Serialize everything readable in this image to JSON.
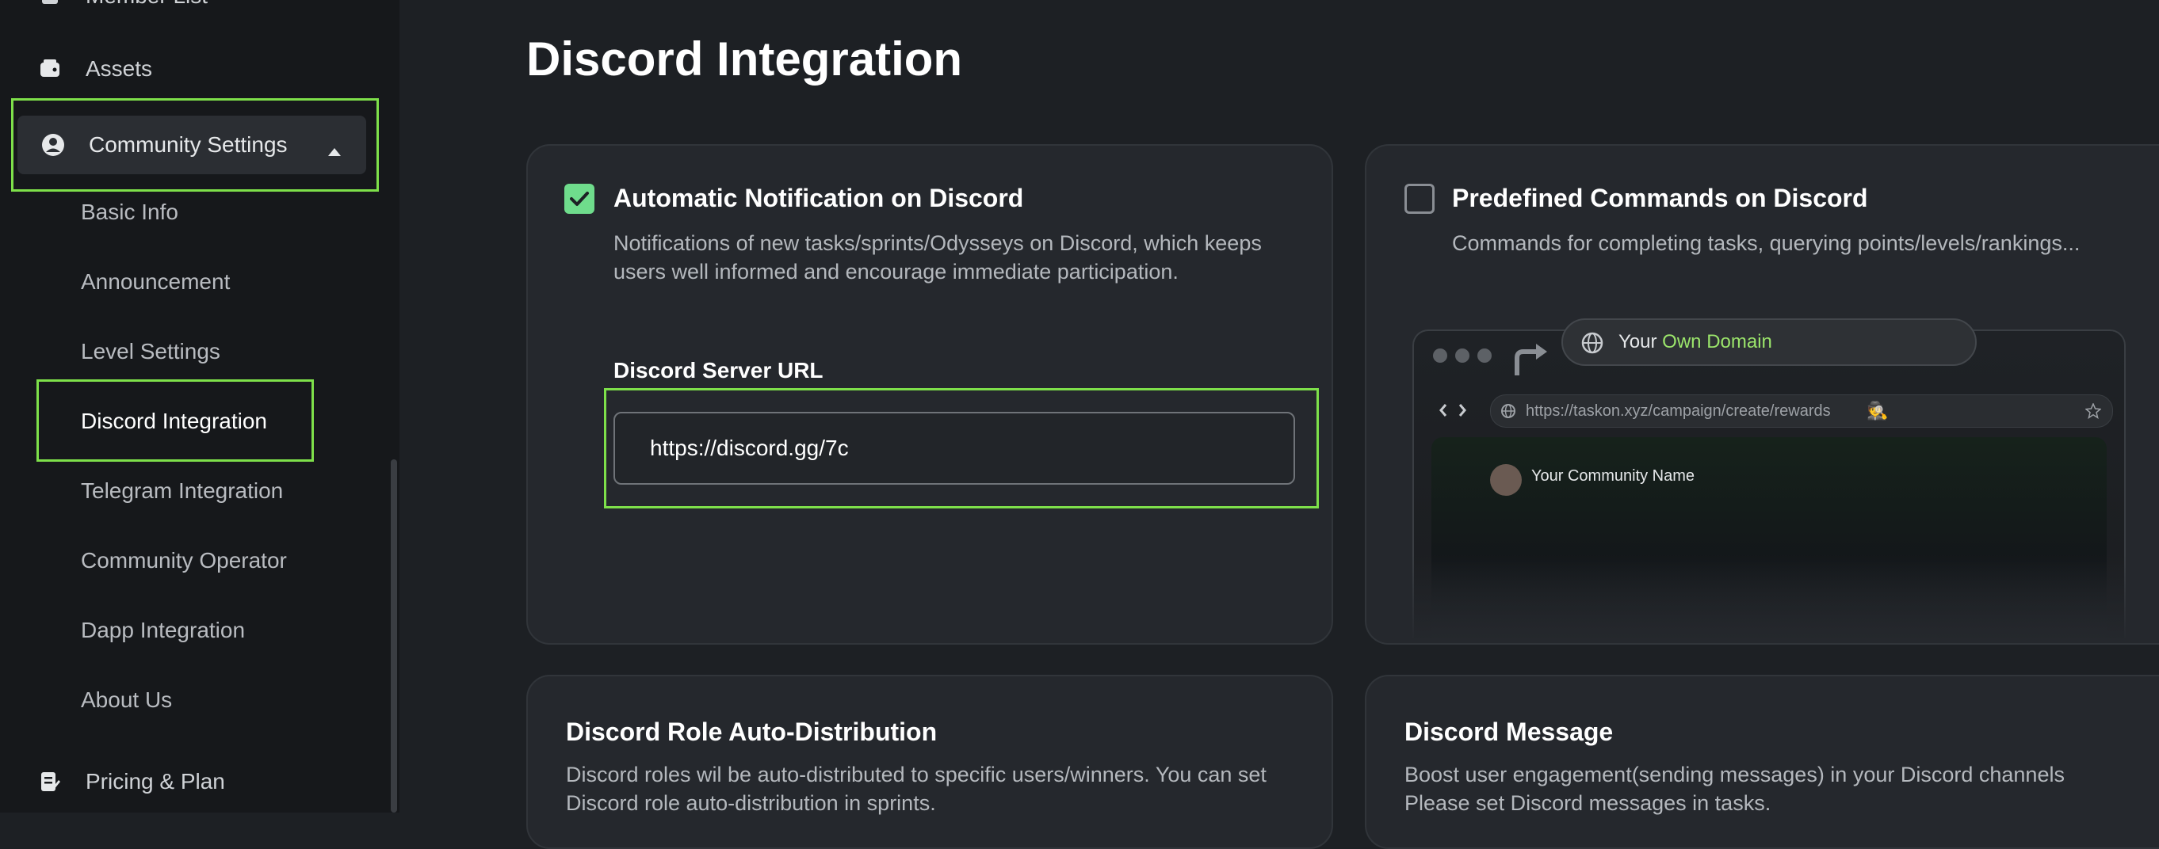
{
  "sidebar": {
    "top_item": "Member List",
    "assets": "Assets",
    "community_settings": "Community Settings",
    "sub_items": [
      "Basic Info",
      "Announcement",
      "Level Settings",
      "Discord Integration",
      "Telegram Integration",
      "Community Operator",
      "Dapp Integration",
      "About Us"
    ],
    "pricing": "Pricing & Plan"
  },
  "page": {
    "title": "Discord Integration"
  },
  "cards": {
    "auto_notification": {
      "title": "Automatic Notification on Discord",
      "desc_line1": "Notifications of new tasks/sprints/Odysseys on Discord, which keeps",
      "desc_line2": "users well informed and encourage immediate participation.",
      "field_label": "Discord Server URL",
      "url_value": "https://discord.gg/7c",
      "checked": true
    },
    "predefined_commands": {
      "title": "Predefined Commands on Discord",
      "desc": "Commands for completing tasks, querying points/levels/rankings...",
      "checked": false,
      "illustration": {
        "domain_prefix": "Your ",
        "domain_highlight": "Own Domain",
        "url": "https://taskon.xyz/campaign/create/rewards",
        "community_name": "Your Community Name"
      }
    },
    "role_distribution": {
      "title": "Discord Role Auto-Distribution",
      "desc_line1": "Discord roles wil be auto-distributed to specific users/winners. You can set",
      "desc_line2": "Discord role auto-distribution in sprints."
    },
    "discord_message": {
      "title": "Discord Message",
      "desc_line1": "Boost user engagement(sending messages) in your Discord channels",
      "desc_line2": "Please set Discord messages in tasks."
    }
  },
  "colors": {
    "accent_green": "#6fdc8c",
    "highlight_outline": "#7ee04a",
    "domain_green": "#9be56b"
  }
}
